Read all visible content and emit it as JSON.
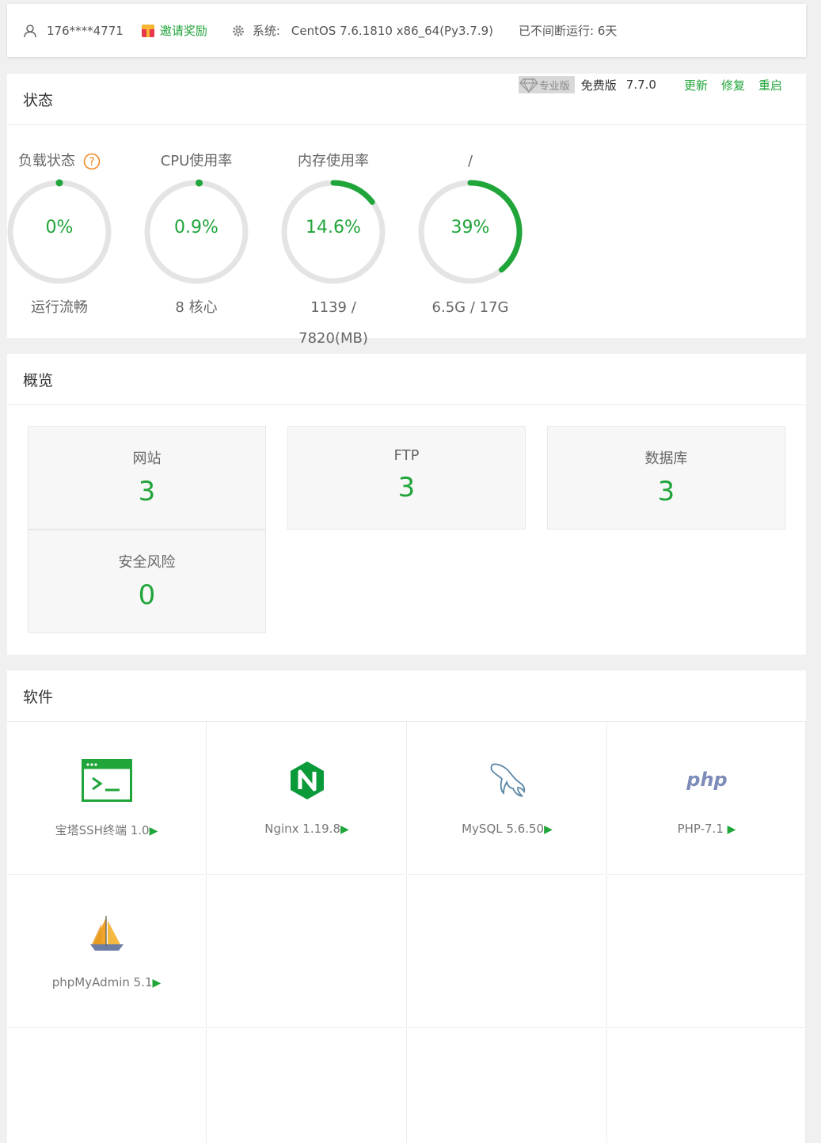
{
  "topbar": {
    "username": "176****4771",
    "invite_label": "邀请奖励",
    "system_label": "系统:",
    "system_value": "CentOS 7.6.1810 x86_64(Py3.7.9)",
    "uptime": "已不间断运行: 6天"
  },
  "status": {
    "title": "状态",
    "pro_label": "专业版",
    "free_label": "免费版",
    "version": "7.7.0",
    "update_label": "更新",
    "repair_label": "修复",
    "restart_label": "重启",
    "gauges": [
      {
        "title": "负载状态",
        "value": "0%",
        "percent": 0,
        "sub": "运行流畅"
      },
      {
        "title": "CPU使用率",
        "value": "0.9%",
        "percent": 0.9,
        "sub": "8 核心"
      },
      {
        "title": "内存使用率",
        "value": "14.6%",
        "percent": 14.6,
        "sub": "1139 / 7820(MB)"
      },
      {
        "title": "/",
        "value": "39%",
        "percent": 39,
        "sub": "6.5G / 17G"
      }
    ]
  },
  "overview": {
    "title": "概览",
    "cards": [
      {
        "label": "网站",
        "value": "3"
      },
      {
        "label": "FTP",
        "value": "3"
      },
      {
        "label": "数据库",
        "value": "3"
      },
      {
        "label": "安全风险",
        "value": "0"
      }
    ]
  },
  "software": {
    "title": "软件",
    "items": [
      {
        "label": "宝塔SSH终端 1.0",
        "icon": "terminal-icon"
      },
      {
        "label": "Nginx 1.19.8",
        "icon": "nginx-icon"
      },
      {
        "label": "MySQL 5.6.50",
        "icon": "mysql-dolphin-icon"
      },
      {
        "label": "PHP-7.1",
        "icon": "php-icon"
      },
      {
        "label": "phpMyAdmin 5.1",
        "icon": "phpmyadmin-sailboat-icon"
      }
    ]
  },
  "colors": {
    "accent": "#20a53a",
    "ring_track": "#e4e4e4",
    "warning": "#f0851e"
  }
}
